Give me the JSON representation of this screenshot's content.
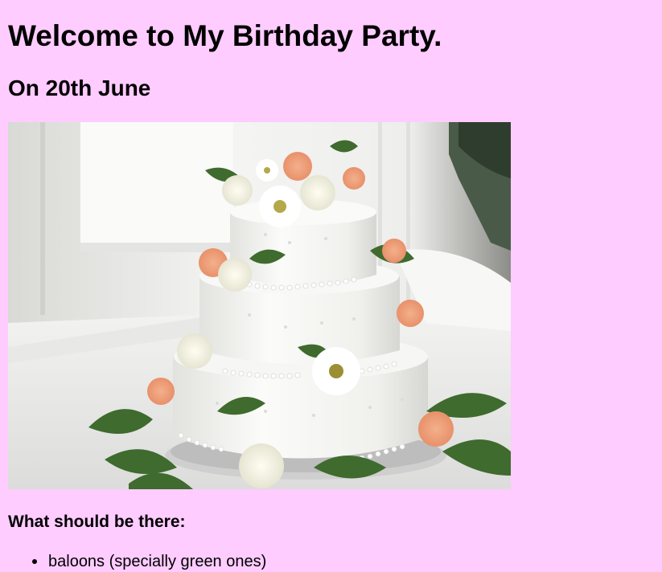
{
  "page": {
    "title": "Welcome to My Birthday Party.",
    "subtitle": "On 20th June",
    "section_heading": "What should be there:",
    "list_items": [
      "baloons (specially green ones)"
    ]
  },
  "colors": {
    "background": "#ffccff",
    "text": "#000000"
  },
  "image": {
    "semantic": "three-tier white wedding cake with roses and daisies"
  }
}
